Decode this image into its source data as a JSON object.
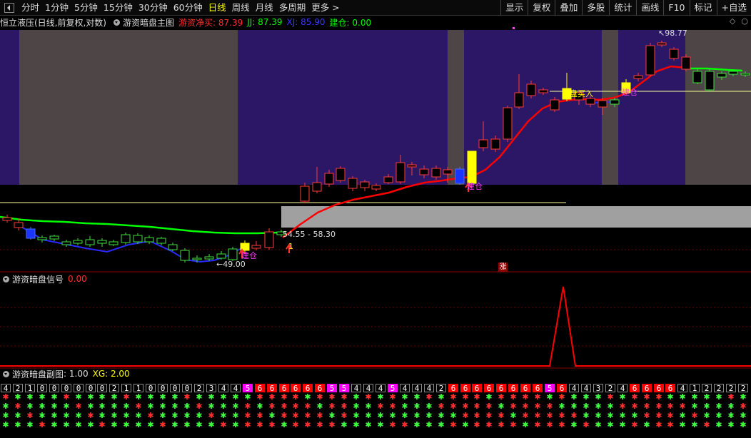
{
  "toolbar": {
    "periods": [
      "分时",
      "1分钟",
      "5分钟",
      "15分钟",
      "30分钟",
      "60分钟",
      "日线",
      "周线",
      "月线",
      "多周期",
      "更多 >"
    ],
    "active_period": "日线",
    "right": [
      "显示",
      "复权",
      "叠加",
      "多股",
      "统计",
      "画线",
      "F10",
      "标记",
      "+自选"
    ]
  },
  "main_panel": {
    "stock": "恒立液压(日线,前复权,对数)",
    "indicator": "游资暗盘主图",
    "net_buy_label": "游资净买: 87.39",
    "jj_label": "JJ: 87.39",
    "xj_label": "XJ: 85.90",
    "jiancang_label": "建仓: 0.00",
    "annotations": {
      "high": "98.77",
      "low": "49.00",
      "range": "54.55 - 58.30",
      "buy": "暗盘买入",
      "jiancang": "建仓",
      "zhang": "涨",
      "one": "1"
    },
    "colors": {
      "band": "#2b1766",
      "grey": "#4e4546",
      "up": "#ff3a3a",
      "down": "#3fe03f",
      "red_line": "#ff0000",
      "green_line": "#00ff00",
      "blue_line": "#2a2aff"
    }
  },
  "signal_panel": {
    "title": "游资暗盘信号",
    "value": "0.00"
  },
  "sub_panel": {
    "title": "游资暗盘副图",
    "value": ": 1.00",
    "xg": "XG: 2.00",
    "digits": [
      "4",
      "2",
      "1",
      "0",
      "0",
      "0",
      "0",
      "0",
      "0",
      "2",
      "1",
      "1",
      "0",
      "0",
      "0",
      "0",
      "2",
      "3",
      "4",
      "4",
      "5",
      "6",
      "6",
      "6",
      "6",
      "6",
      "6",
      "5",
      "5",
      "4",
      "4",
      "4",
      "5",
      "4",
      "4",
      "4",
      "2",
      "6",
      "6",
      "6",
      "6",
      "6",
      "6",
      "6",
      "6",
      "5",
      "6",
      "4",
      "4",
      "3",
      "2",
      "4",
      "6",
      "6",
      "6",
      "6",
      "4",
      "1",
      "2",
      "2",
      "2",
      "2"
    ]
  }
}
